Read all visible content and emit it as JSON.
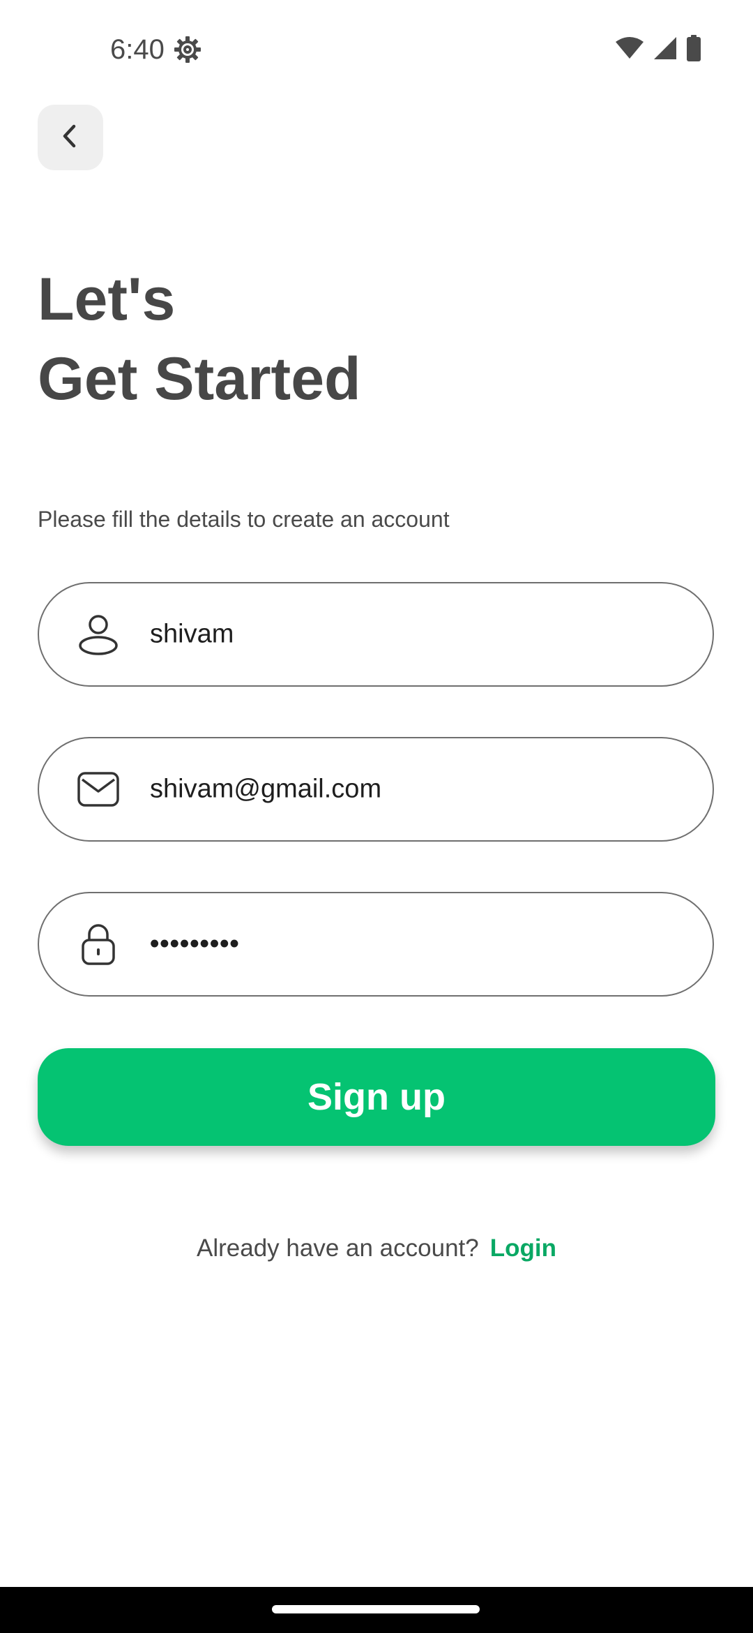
{
  "status_bar": {
    "time": "6:40",
    "icons": [
      "gear-icon",
      "wifi-icon",
      "signal-icon",
      "battery-icon"
    ]
  },
  "header": {
    "back_icon": "chevron-left-icon"
  },
  "title": {
    "line1": "Let's",
    "line2": "Get Started"
  },
  "subtitle": "Please fill the details to create an account",
  "form": {
    "name": {
      "icon": "user-icon",
      "value": "shivam"
    },
    "email": {
      "icon": "mail-icon",
      "value": "shivam@gmail.com"
    },
    "password": {
      "icon": "lock-icon",
      "value": "•••••••••"
    }
  },
  "signup_button": {
    "label": "Sign up"
  },
  "login": {
    "prompt": "Already have an account?",
    "link": "Login"
  },
  "colors": {
    "accent": "#05c372",
    "link": "#0aa864",
    "title": "#474747",
    "nav_bar": "#000000"
  }
}
